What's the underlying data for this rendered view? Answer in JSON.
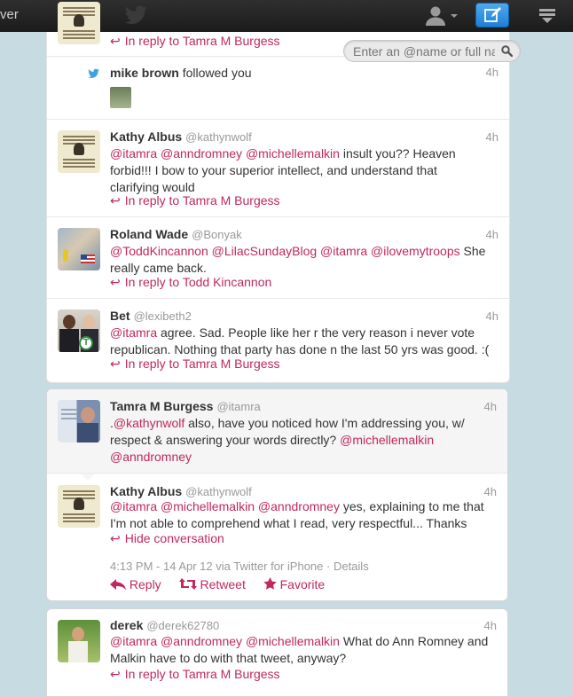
{
  "topbar": {
    "brand_fragment": "ver",
    "icons": [
      "twitter-bird-icon",
      "person-icon",
      "compose-icon",
      "more-icon"
    ],
    "compose_color": "#2b8fe3"
  },
  "search": {
    "placeholder": "Enter an @name or full name"
  },
  "colors": {
    "mention": "#c0285f",
    "link": "#c0285f",
    "time": "#999999"
  },
  "feed": {
    "top_reply": "In reply to Tamra M Burgess",
    "follow": {
      "name": "mike brown",
      "text": "followed you",
      "time": "4h"
    },
    "tweets": [
      {
        "name": "Kathy Albus",
        "handle": "@kathynwolf",
        "time": "4h",
        "m1": "@itamra",
        "m2": "@anndromney",
        "m3": "@michellemalkin",
        "body1": "insult you?? Heaven",
        "body2": "forbid!!! I bow to your superior intellect, and understand that",
        "body3": "clarifying would",
        "reply": "In reply to Tamra M Burgess"
      },
      {
        "name": "Roland Wade",
        "handle": "@Bonyak",
        "time": "4h",
        "m1": "@ToddKincannon",
        "m2": "@LilacSundayBlog",
        "m3": "@itamra",
        "m4": "@ilovemytroops",
        "body1": "She",
        "body2": "really came back.",
        "reply": "In reply to Todd Kincannon"
      },
      {
        "name": "Bet",
        "handle": "@lexibeth2",
        "time": "4h",
        "m1": "@itamra",
        "body1": "agree. Sad. People like her r the very reason i never vote",
        "body2": "republican. Nothing that party has done n the last 50 yrs was good. :(",
        "reply": "In reply to Tamra M Burgess"
      }
    ]
  },
  "conversation": {
    "parent": {
      "name": "Tamra M Burgess",
      "handle": "@itamra",
      "time": "4h",
      "prefix": ".",
      "m1": "@kathynwolf",
      "body1": "also, have you noticed how I'm addressing you, w/",
      "body2": "respect & answering your words directly?",
      "m2": "@michellemalkin",
      "m3": "@anndromney"
    },
    "main": {
      "name": "Kathy Albus",
      "handle": "@kathynwolf",
      "time": "4h",
      "m1": "@itamra",
      "m2": "@michellemalkin",
      "m3": "@anndromney",
      "body1": "yes, explaining to me that",
      "body2": "I'm not able to comprehend what I read, very respectful... Thanks",
      "hide": "Hide conversation",
      "meta": "4:13 PM - 14 Apr 12 via Twitter for iPhone",
      "details": "Details",
      "reply": "Reply",
      "retweet": "Retweet",
      "favorite": "Favorite"
    }
  },
  "bottom": {
    "name": "derek",
    "handle": "@derek62780",
    "time": "4h",
    "m1": "@itamra",
    "m2": "@anndromney",
    "m3": "@michellemalkin",
    "body1": "What do Ann Romney and",
    "body2": "Malkin have to do with that tweet, anyway?",
    "reply": "In reply to Tamra M Burgess"
  }
}
